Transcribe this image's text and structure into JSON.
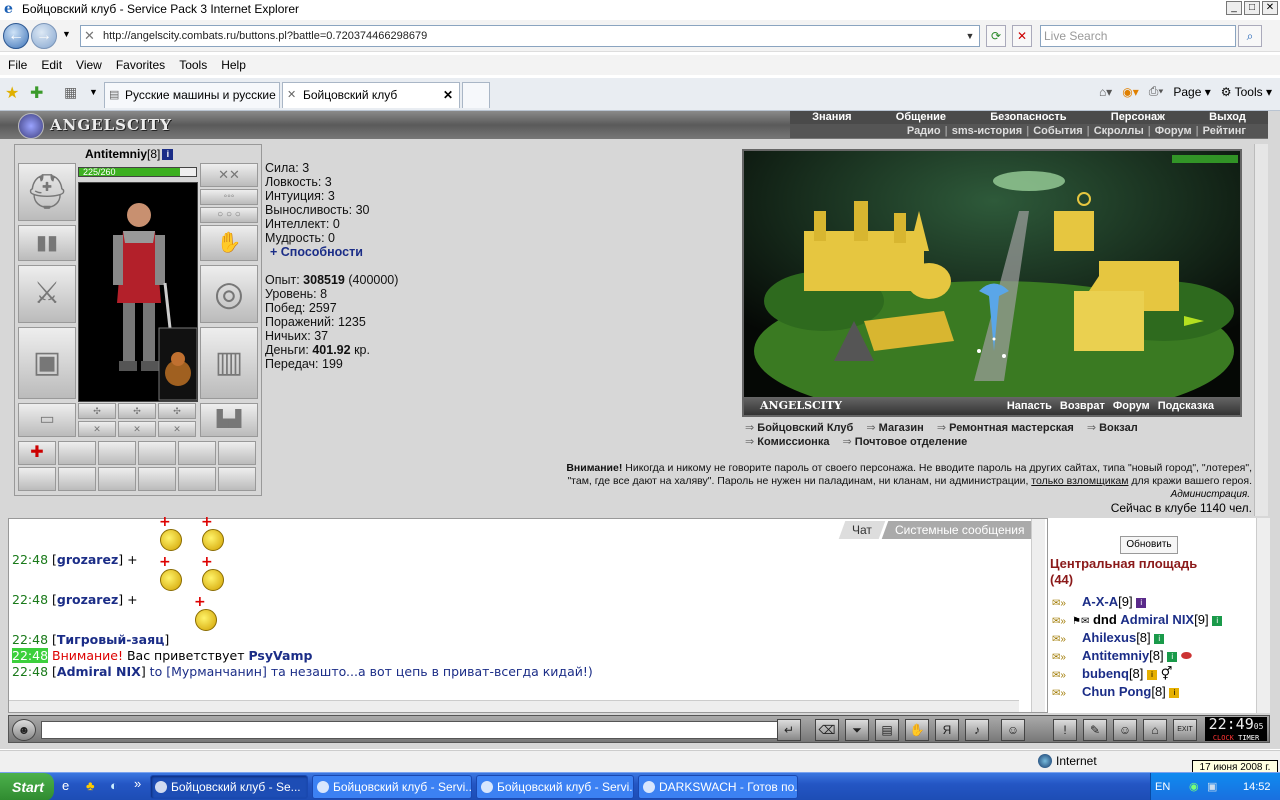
{
  "window": {
    "title": "Бойцовский клуб - Service Pack 3 Internet Explorer"
  },
  "address": {
    "url": "http://angelscity.combats.ru/buttons.pl?battle=0.720374466298679",
    "search_placeholder": "Live Search"
  },
  "menu": [
    "File",
    "Edit",
    "View",
    "Favorites",
    "Tools",
    "Help"
  ],
  "tabs": [
    {
      "label": "Русские машины и русские ..."
    },
    {
      "label": "Бойцовский клуб"
    }
  ],
  "ie_tools": {
    "page": "Page",
    "tools": "Tools"
  },
  "site": {
    "logo": "ANGELSCITY",
    "nav_top": [
      "Знания",
      "Общение",
      "Безопасность",
      "Персонаж",
      "Выход"
    ],
    "nav_sub": [
      "Радио",
      "sms-история",
      "События",
      "Скроллы",
      "Форум",
      "Рейтинг"
    ]
  },
  "character": {
    "name": "Antitemniy",
    "level": "[8]",
    "hp": "225/260",
    "hp_fraction": 0.865
  },
  "stats": {
    "lines": [
      "Сила: 3",
      "Ловкость: 3",
      "Интуиция: 3",
      "Выносливость: 30",
      "Интеллект: 0",
      "Мудрость: 0"
    ],
    "abilities": "+ Способности",
    "exp_label": "Опыт:",
    "exp": "308519",
    "exp_next": "(400000)",
    "level": "Уровень: 8",
    "wins": "Побед: 2597",
    "losses": "Поражений: 1235",
    "draws": "Ничьих: 37",
    "money_label": "Деньги:",
    "money": "401.92",
    "money_unit": "кр.",
    "transfers": "Передач: 199"
  },
  "map": {
    "name": "ANGELSCITY",
    "actions": [
      "Напасть",
      "Возврат",
      "Форум",
      "Подсказка"
    ],
    "locations_row1": [
      "Бойцовский Клуб",
      "Магазин",
      "Ремонтная мастерская",
      "Вокзал"
    ],
    "locations_row2": [
      "Комиссионка",
      "Почтовое отделение"
    ]
  },
  "warning": {
    "bold": "Внимание!",
    "text1": " Никогда и никому не говорите пароль от своего персонажа. Не вводите пароль на других сайтах, типа \"новый город\", \"лотерея\",",
    "text2": "\"там, где все дают на халяву\". Пароль не нужен ни паладинам, ни кланам, ни администрации, ",
    "link": "только взломщикам",
    "text3": " для кражи вашего героя.",
    "admin": "Администрация.",
    "online": "Сейчас в клубе 1140 чел."
  },
  "chat": {
    "tab_chat": "Чат",
    "tab_system": "Системные сообщения",
    "lines": [
      {
        "time": "22:48",
        "nick": "grozarez",
        "text": " +"
      },
      {
        "time": "22:48",
        "nick": "grozarez",
        "text": " +"
      },
      {
        "time": "22:48",
        "nick": "Тигровый-заяц",
        "text": ""
      },
      {
        "time": "22:48",
        "alert": "Внимание!",
        "text": " Вас приветствует ",
        "who": "PsyVamp"
      },
      {
        "time": "22:48",
        "nick": "Admiral NIX",
        "text": " to [Мурманчанин] та незаштo...а вот цепь в приват-всегда кидай!)"
      }
    ]
  },
  "users": {
    "refresh": "Обновить",
    "room": "Центральная площадь",
    "count": "(44)",
    "list": [
      {
        "name": "A-X-A",
        "level": "[9]",
        "badge": "p"
      },
      {
        "prefix": "dnd",
        "name": "Admiral NIX",
        "level": "[9]",
        "badge": "g"
      },
      {
        "name": "Ahilexus",
        "level": "[8]",
        "badge": "g"
      },
      {
        "name": "Antitemniy",
        "level": "[8]",
        "badge": "g"
      },
      {
        "name": "bubenq",
        "level": "[8]",
        "badge": "y"
      },
      {
        "name": "Chun Pong",
        "level": "[8]",
        "badge": "y"
      }
    ]
  },
  "clock": {
    "time": "22:49",
    "sub": "05",
    "label1": "CLOCK",
    "label2": "TIMER"
  },
  "statusbar": {
    "zone": "Internet",
    "tooltip": "17 июня 2008 г."
  },
  "taskbar": {
    "start": "Start",
    "items": [
      "Бойцовский клуб - Se...",
      "Бойцовский клуб - Servi...",
      "Бойцовский клуб - Servi...",
      "DARKSWACH - Готов по..."
    ],
    "lang": "EN",
    "time": "14:52"
  }
}
